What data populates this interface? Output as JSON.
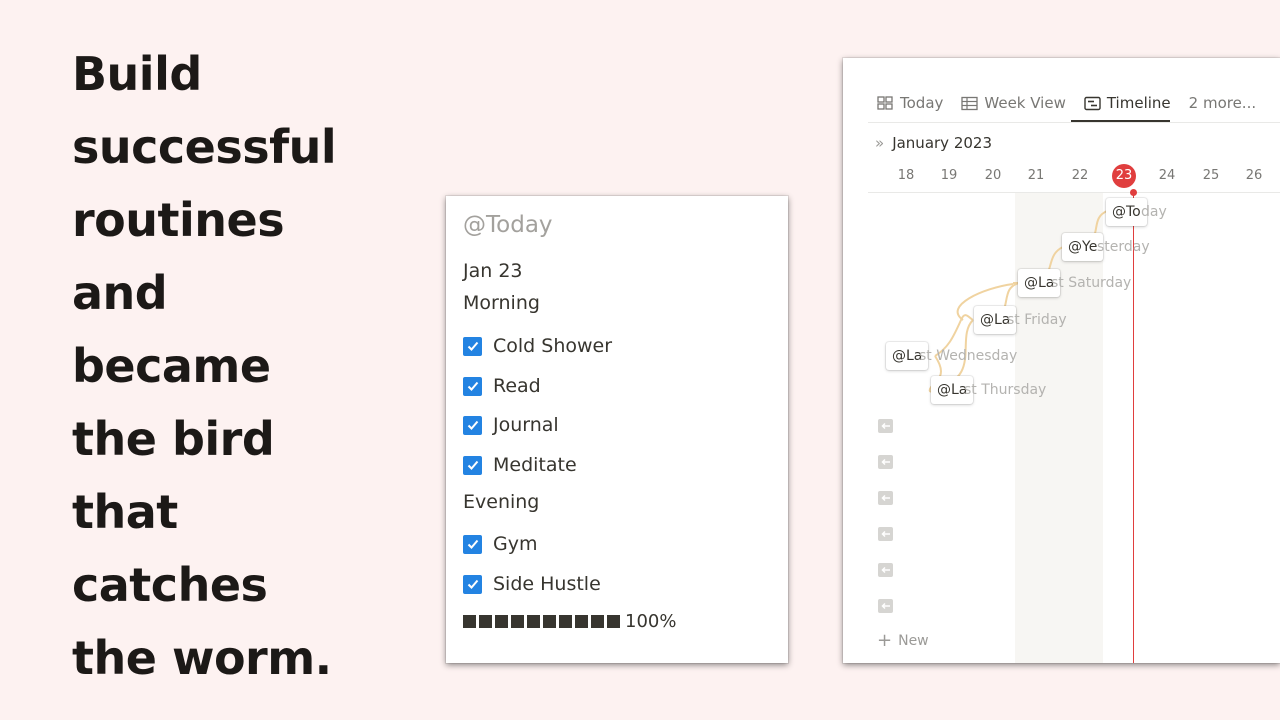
{
  "headline": {
    "lines": [
      "Build",
      "successful",
      "routines",
      "and",
      "became",
      "the bird",
      "that",
      "catches",
      "the worm."
    ]
  },
  "checklist": {
    "title": "@Today",
    "date": "Jan 23",
    "morning_label": "Morning",
    "morning_items": [
      "Cold Shower",
      "Read",
      "Journal",
      "Meditate"
    ],
    "evening_label": "Evening",
    "evening_items": [
      "Gym",
      "Side Hustle"
    ],
    "progress": {
      "blocks": 10,
      "filled": 10,
      "percent_label": "100%"
    },
    "checkbox_color": "#2383e2"
  },
  "timeline": {
    "tabs": [
      {
        "label": "Today",
        "icon": "grid-icon",
        "active": false
      },
      {
        "label": "Week View",
        "icon": "table-icon",
        "active": false
      },
      {
        "label": "Timeline",
        "icon": "timeline-icon",
        "active": true
      },
      {
        "label": "2 more...",
        "icon": "",
        "active": false
      }
    ],
    "month": "January 2023",
    "days": [
      "18",
      "19",
      "20",
      "21",
      "22",
      "23",
      "24",
      "25",
      "26"
    ],
    "today_day": "23",
    "today_color": "#e03e3e",
    "items": [
      {
        "pill": "@To",
        "ghost": "day"
      },
      {
        "pill": "@Ye",
        "ghost": "sterday"
      },
      {
        "pill": "@La",
        "ghost": "st Saturday"
      },
      {
        "pill": "@La",
        "ghost": "st Friday"
      },
      {
        "pill": "@La",
        "ghost": "st Wednesday"
      },
      {
        "pill": "@La",
        "ghost": "st Thursday"
      }
    ],
    "new_label": "New"
  }
}
